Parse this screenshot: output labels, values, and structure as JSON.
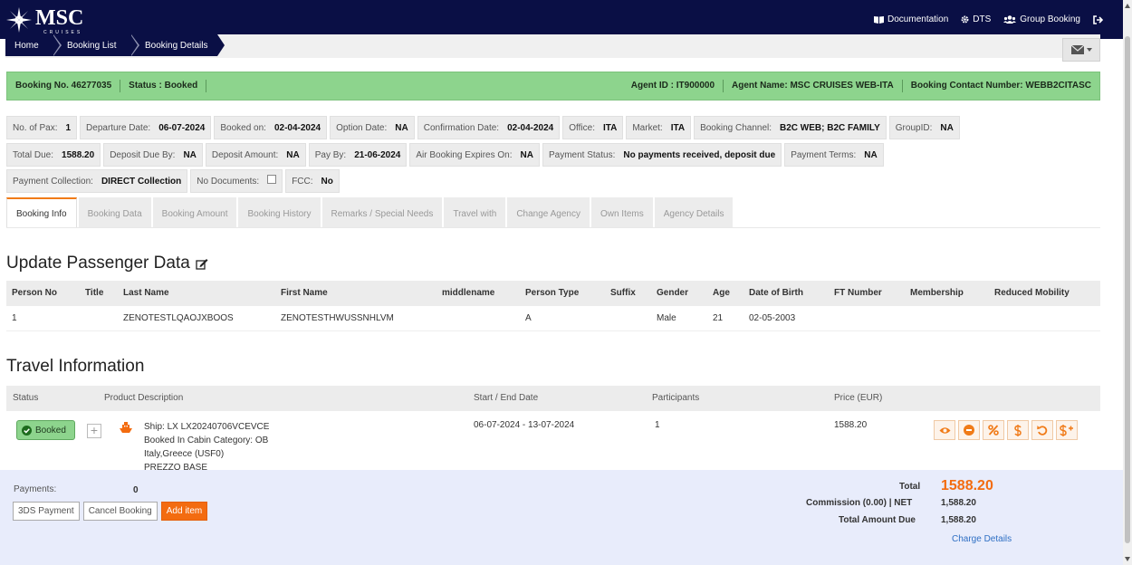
{
  "brand": {
    "name": "MSC",
    "sub": "CRUISES"
  },
  "nav": {
    "documentation": "Documentation",
    "dts": "DTS",
    "group_booking": "Group Booking"
  },
  "breadcrumb": [
    "Home",
    "Booking List",
    "Booking Details"
  ],
  "booking_bar": {
    "booking_no": "Booking No. 46277035",
    "status": "Status : Booked",
    "agent_id": "Agent ID : IT900000",
    "agent_name": "Agent Name: MSC CRUISES WEB-ITA",
    "contact": "Booking Contact Number: WEBB2CITASC"
  },
  "info": {
    "row1": [
      {
        "label": "No. of Pax:",
        "value": "1"
      },
      {
        "label": "Departure Date:",
        "value": "06-07-2024"
      },
      {
        "label": "Booked on:",
        "value": "02-04-2024"
      },
      {
        "label": "Option Date:",
        "value": "NA"
      },
      {
        "label": "Confirmation Date:",
        "value": "02-04-2024"
      },
      {
        "label": "Office:",
        "value": "ITA"
      },
      {
        "label": "Market:",
        "value": "ITA"
      },
      {
        "label": "Booking Channel:",
        "value": "B2C WEB; B2C FAMILY"
      },
      {
        "label": "GroupID:",
        "value": "NA"
      }
    ],
    "row2": [
      {
        "label": "Total Due:",
        "value": "1588.20"
      },
      {
        "label": "Deposit Due By:",
        "value": "NA"
      },
      {
        "label": "Deposit Amount:",
        "value": "NA"
      },
      {
        "label": "Pay By:",
        "value": "21-06-2024"
      },
      {
        "label": "Air Booking Expires On:",
        "value": "NA"
      },
      {
        "label": "Payment Status:",
        "value": "No payments received, deposit due"
      },
      {
        "label": "Payment Terms:",
        "value": "NA"
      }
    ],
    "row3": [
      {
        "label": "Payment Collection:",
        "value": "DIRECT Collection"
      },
      {
        "label": "No Documents:",
        "value": ""
      },
      {
        "label": "FCC:",
        "value": "No"
      }
    ]
  },
  "tabs": [
    "Booking Info",
    "Booking Data",
    "Booking Amount",
    "Booking History",
    "Remarks / Special Needs",
    "Travel with",
    "Change Agency",
    "Own Items",
    "Agency Details"
  ],
  "passenger": {
    "title": "Update Passenger Data",
    "headers": [
      "Person No",
      "Title",
      "Last Name",
      "First Name",
      "middlename",
      "Person Type",
      "Suffix",
      "Gender",
      "Age",
      "Date of Birth",
      "FT Number",
      "Membership",
      "Reduced Mobility"
    ],
    "rows": [
      [
        "1",
        "",
        "ZENOTESTLQAOJXBOOS",
        "ZENOTESTHWUSSNHLVM",
        "",
        "A",
        "",
        "Male",
        "21",
        "02-05-2003",
        "",
        "",
        ""
      ]
    ]
  },
  "travel": {
    "title": "Travel Information",
    "headers": [
      "Status",
      "Product Description",
      "Start / End Date",
      "Participants",
      "Price (EUR)"
    ],
    "row": {
      "status": "Booked",
      "desc": [
        "Ship: LX LX20240706VCEVCE",
        "Booked In Cabin Category: OB",
        "Italy,Greece (USF0)",
        "PREZZO BASE"
      ],
      "dates": "06-07-2024 - 13-07-2024",
      "participants": "1",
      "price": "1588.20"
    },
    "action_icons": [
      "eye-icon",
      "minus-circle-icon",
      "percent-icon",
      "dollar-icon",
      "undo-icon",
      "dollar-plus-icon"
    ]
  },
  "footer": {
    "payments_label": "Payments:",
    "payments_count": "0",
    "btn_3ds": "3DS Payment",
    "btn_cancel": "Cancel Booking",
    "btn_add": "Add item",
    "total_label": "Total",
    "total_value": "1588.20",
    "commission_label": "Commission (0.00) | NET",
    "commission_value": "1,588.20",
    "total_amount_label": "Total Amount Due",
    "total_amount_value": "1,588.20",
    "charge_details": "Charge Details"
  },
  "colors": {
    "navy": "#0a0f45",
    "green": "#8dd48d",
    "orange": "#f36c10"
  }
}
